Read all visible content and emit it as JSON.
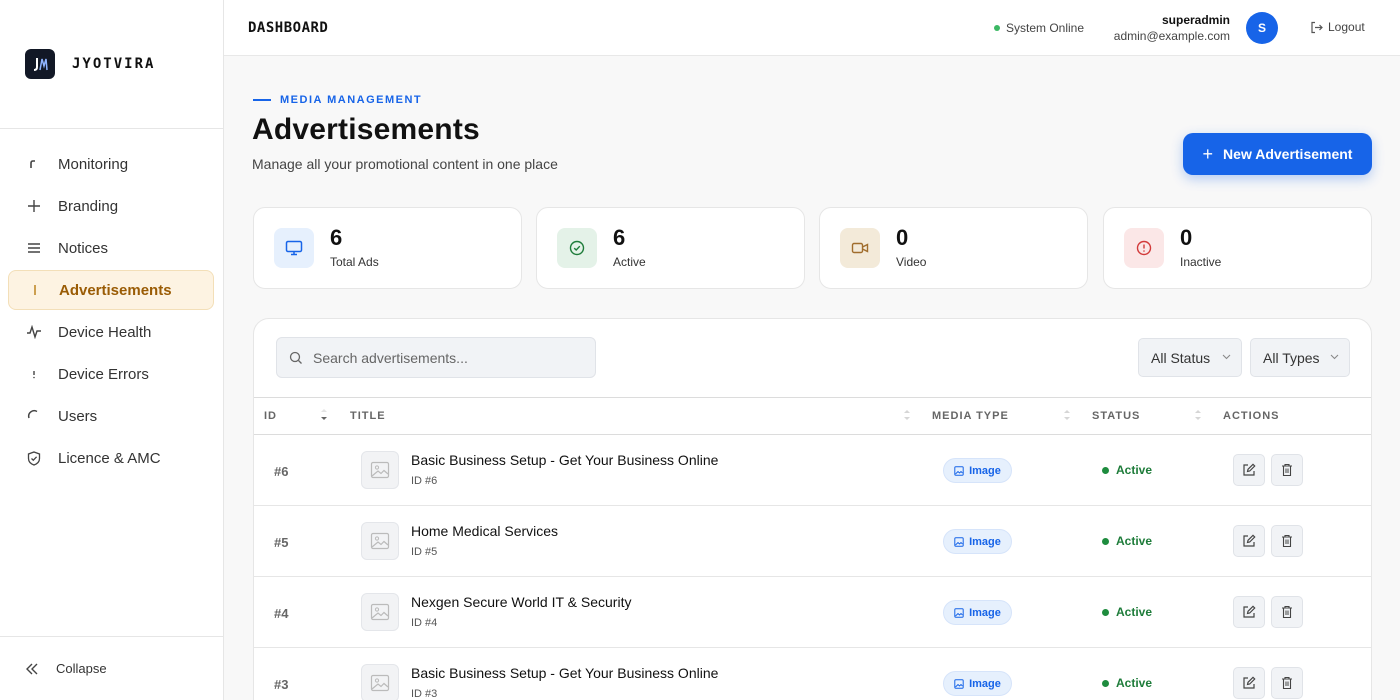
{
  "brand": {
    "name": "JYOTVIRA",
    "logo_text": "J"
  },
  "sidebar": {
    "items": [
      {
        "label": "Monitoring",
        "icon": "monitoring-icon"
      },
      {
        "label": "Branding",
        "icon": "plus-icon"
      },
      {
        "label": "Notices",
        "icon": "list-icon"
      },
      {
        "label": "Advertisements",
        "icon": "ads-icon",
        "active": true
      },
      {
        "label": "Device Health",
        "icon": "pulse-icon"
      },
      {
        "label": "Device Errors",
        "icon": "alert-icon"
      },
      {
        "label": "Users",
        "icon": "users-icon"
      },
      {
        "label": "Licence & AMC",
        "icon": "shield-check-icon"
      }
    ],
    "collapse_label": "Collapse"
  },
  "topbar": {
    "title": "DASHBOARD",
    "system_status": "System Online",
    "user_name": "superadmin",
    "user_email": "admin@example.com",
    "avatar_initial": "S",
    "logout_label": "Logout"
  },
  "header": {
    "section_tag": "MEDIA MANAGEMENT",
    "title": "Advertisements",
    "subtitle": "Manage all your promotional content in one place",
    "new_button_label": "New Advertisement"
  },
  "stats": [
    {
      "value": "6",
      "label": "Total Ads",
      "icon": "monitor-icon",
      "color": "#1764e8",
      "bg": "#e6f0fd"
    },
    {
      "value": "6",
      "label": "Active",
      "icon": "check-circle-icon",
      "color": "#1e7c3a",
      "bg": "#e4f2e8"
    },
    {
      "value": "0",
      "label": "Video",
      "icon": "video-icon",
      "color": "#a06d2c",
      "bg": "#f3ead9"
    },
    {
      "value": "0",
      "label": "Inactive",
      "icon": "alert-circle-icon",
      "color": "#d23a3a",
      "bg": "#fbe7e7"
    }
  ],
  "table": {
    "search_placeholder": "Search advertisements...",
    "filter_status": "All Status",
    "filter_types": "All Types",
    "columns": [
      "ID",
      "TITLE",
      "MEDIA TYPE",
      "STATUS",
      "ACTIONS"
    ],
    "rows": [
      {
        "id": "#6",
        "title": "Basic Business Setup - Get Your Business Online",
        "sub": "ID #6",
        "media": "Image",
        "status": "Active"
      },
      {
        "id": "#5",
        "title": "Home Medical Services",
        "sub": "ID #5",
        "media": "Image",
        "status": "Active"
      },
      {
        "id": "#4",
        "title": "Nexgen Secure World IT & Security",
        "sub": "ID #4",
        "media": "Image",
        "status": "Active"
      },
      {
        "id": "#3",
        "title": "Basic Business Setup - Get Your Business Online",
        "sub": "ID #3",
        "media": "Image",
        "status": "Active"
      }
    ]
  }
}
